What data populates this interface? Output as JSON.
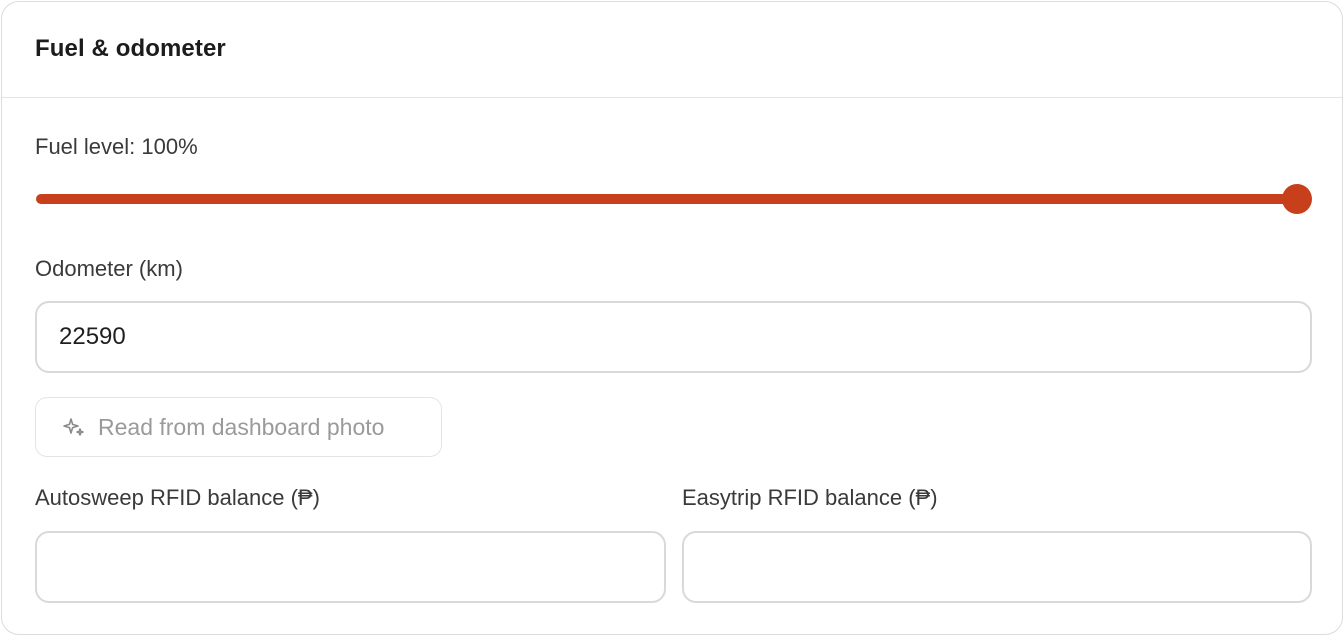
{
  "card": {
    "title": "Fuel & odometer"
  },
  "fuel": {
    "label": "Fuel level: 100%",
    "level_percent": 100,
    "accent_color": "#c8401b"
  },
  "odometer": {
    "label": "Odometer (km)",
    "value": "22590"
  },
  "photo_button": {
    "label": "Read from dashboard photo",
    "icon": "sparkles-icon"
  },
  "autosweep": {
    "label": "Autosweep RFID balance (₱)",
    "value": ""
  },
  "easytrip": {
    "label": "Easytrip RFID balance (₱)",
    "value": ""
  }
}
